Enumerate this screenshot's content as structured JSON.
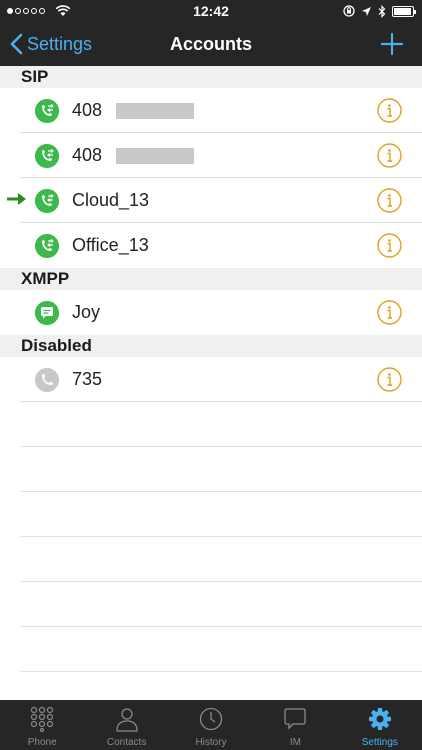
{
  "status_bar": {
    "time": "12:42",
    "signal_dots_filled": 1,
    "signal_dots_total": 5
  },
  "nav": {
    "back_label": "Settings",
    "title": "Accounts"
  },
  "sections": [
    {
      "title": "SIP",
      "accounts": [
        {
          "label": "408",
          "masked": true,
          "icon": "sip-account-icon",
          "status": "active"
        },
        {
          "label": "408",
          "masked": true,
          "icon": "sip-account-icon",
          "status": "active"
        },
        {
          "label": "Cloud_13",
          "masked": false,
          "icon": "sip-account-icon",
          "status": "active",
          "default": true
        },
        {
          "label": "Office_13",
          "masked": false,
          "icon": "sip-account-icon",
          "status": "active"
        }
      ]
    },
    {
      "title": "XMPP",
      "accounts": [
        {
          "label": "Joy",
          "masked": false,
          "icon": "chat-bubble-icon",
          "status": "active"
        }
      ]
    },
    {
      "title": "Disabled",
      "accounts": [
        {
          "label": "735",
          "masked": false,
          "icon": "phone-handset-icon",
          "status": "disabled"
        }
      ]
    }
  ],
  "tabs": [
    {
      "label": "Phone",
      "icon": "dialpad-icon",
      "active": false
    },
    {
      "label": "Contacts",
      "icon": "person-icon",
      "active": false
    },
    {
      "label": "History",
      "icon": "clock-icon",
      "active": false
    },
    {
      "label": "IM",
      "icon": "chat-bubble-icon",
      "active": false
    },
    {
      "label": "Settings",
      "icon": "gear-icon",
      "active": true
    }
  ],
  "colors": {
    "accent_blue": "#4ab0f0",
    "account_green": "#3cb94a",
    "info_orange": "#e0a020",
    "bar_dark": "#262626",
    "section_gray": "#f0f0f0"
  }
}
